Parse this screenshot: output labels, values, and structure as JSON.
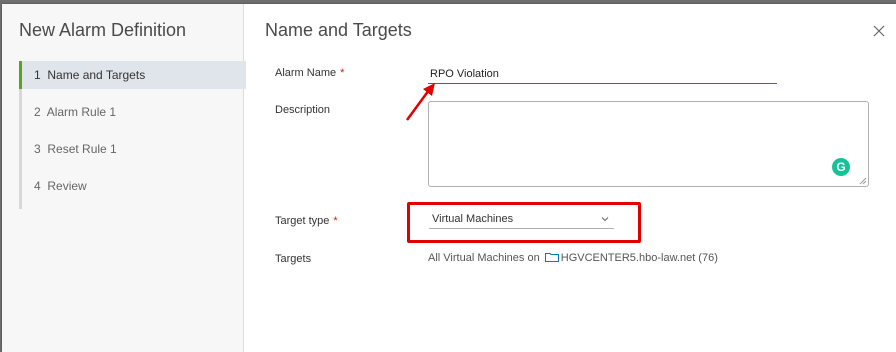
{
  "sidebar": {
    "title": "New Alarm Definition",
    "steps": [
      {
        "num": "1",
        "label": "Name and Targets",
        "active": true
      },
      {
        "num": "2",
        "label": "Alarm Rule 1",
        "active": false
      },
      {
        "num": "3",
        "label": "Reset Rule 1",
        "active": false
      },
      {
        "num": "4",
        "label": "Review",
        "active": false
      }
    ]
  },
  "main": {
    "title": "Name and Targets",
    "form": {
      "alarm_name_label": "Alarm Name",
      "required_mark": "*",
      "alarm_name_value": "RPO Violation",
      "description_label": "Description",
      "description_value": "",
      "target_type_label": "Target type",
      "target_type_value": "Virtual Machines",
      "targets_label": "Targets",
      "targets_prefix": "All Virtual Machines on",
      "targets_vcenter": "HGVCENTER5.hbo-law.net (76)"
    }
  },
  "icons": {
    "close": "close-icon",
    "chevron": "chevron-down-icon",
    "folder": "folder-icon",
    "grammarly": "grammarly-icon",
    "grammarly_letter": "G"
  },
  "colors": {
    "accent_active": "#5aa220",
    "input_focus": "#0079b8",
    "annotation_red": "#e00000",
    "grammarly": "#15c39a"
  }
}
